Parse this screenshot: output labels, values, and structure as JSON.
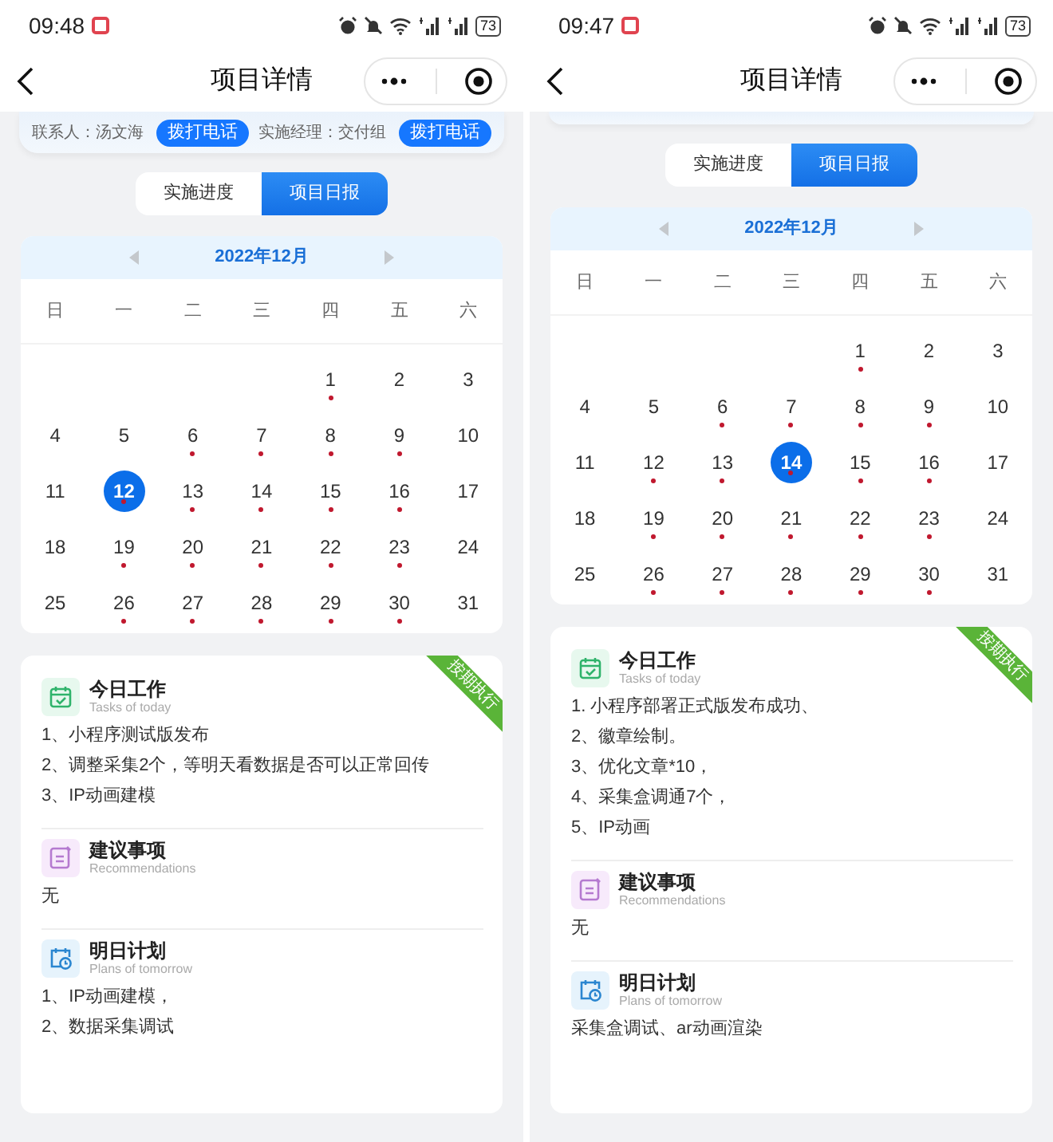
{
  "screens": [
    {
      "status_time": "09:48",
      "battery": "73",
      "title": "项目详情",
      "contacts": [
        {
          "label": "联系人：汤文海",
          "button": "拨打电话"
        },
        {
          "label": "实施经理：交付组",
          "button": "拨打电话"
        }
      ],
      "tabs": [
        {
          "label": "实施进度",
          "selected": false
        },
        {
          "label": "项目日报",
          "selected": true
        }
      ],
      "calendar": {
        "month": "2022年12月",
        "weekdays": [
          "日",
          "一",
          "二",
          "三",
          "四",
          "五",
          "六"
        ],
        "days": [
          {
            "kind": "blank"
          },
          {
            "kind": "blank"
          },
          {
            "kind": "blank"
          },
          {
            "kind": "blank"
          },
          {
            "kind": "day",
            "label": "1",
            "marked": true,
            "selected": false
          },
          {
            "kind": "day",
            "label": "2",
            "marked": false,
            "selected": false
          },
          {
            "kind": "day",
            "label": "3",
            "marked": false,
            "selected": false
          },
          {
            "kind": "day",
            "label": "4",
            "marked": false,
            "selected": false
          },
          {
            "kind": "day",
            "label": "5",
            "marked": false,
            "selected": false
          },
          {
            "kind": "day",
            "label": "6",
            "marked": true,
            "selected": false
          },
          {
            "kind": "day",
            "label": "7",
            "marked": true,
            "selected": false
          },
          {
            "kind": "day",
            "label": "8",
            "marked": true,
            "selected": false
          },
          {
            "kind": "day",
            "label": "9",
            "marked": true,
            "selected": false
          },
          {
            "kind": "day",
            "label": "10",
            "marked": false,
            "selected": false
          },
          {
            "kind": "day",
            "label": "11",
            "marked": false,
            "selected": false
          },
          {
            "kind": "day",
            "label": "12",
            "marked": true,
            "selected": true
          },
          {
            "kind": "day",
            "label": "13",
            "marked": true,
            "selected": false
          },
          {
            "kind": "day",
            "label": "14",
            "marked": true,
            "selected": false
          },
          {
            "kind": "day",
            "label": "15",
            "marked": true,
            "selected": false
          },
          {
            "kind": "day",
            "label": "16",
            "marked": true,
            "selected": false
          },
          {
            "kind": "day",
            "label": "17",
            "marked": false,
            "selected": false
          },
          {
            "kind": "day",
            "label": "18",
            "marked": false,
            "selected": false
          },
          {
            "kind": "day",
            "label": "19",
            "marked": true,
            "selected": false
          },
          {
            "kind": "day",
            "label": "20",
            "marked": true,
            "selected": false
          },
          {
            "kind": "day",
            "label": "21",
            "marked": true,
            "selected": false
          },
          {
            "kind": "day",
            "label": "22",
            "marked": true,
            "selected": false
          },
          {
            "kind": "day",
            "label": "23",
            "marked": true,
            "selected": false
          },
          {
            "kind": "day",
            "label": "24",
            "marked": false,
            "selected": false
          },
          {
            "kind": "day",
            "label": "25",
            "marked": false,
            "selected": false
          },
          {
            "kind": "day",
            "label": "26",
            "marked": true,
            "selected": false
          },
          {
            "kind": "day",
            "label": "27",
            "marked": true,
            "selected": false
          },
          {
            "kind": "day",
            "label": "28",
            "marked": true,
            "selected": false
          },
          {
            "kind": "day",
            "label": "29",
            "marked": true,
            "selected": false
          },
          {
            "kind": "day",
            "label": "30",
            "marked": true,
            "selected": false
          },
          {
            "kind": "day",
            "label": "31",
            "marked": false,
            "selected": false
          }
        ]
      },
      "ribbon": "按期执行",
      "sections": [
        {
          "kind": "tasks",
          "title": "今日工作",
          "subtitle": "Tasks of today",
          "lines": [
            "1、小程序测试版发布",
            "2、调整采集2个，等明天看数据是否可以正常回传",
            "3、IP动画建模"
          ]
        },
        {
          "kind": "recommend",
          "title": "建议事项",
          "subtitle": "Recommendations",
          "lines": [
            "无"
          ]
        },
        {
          "kind": "plan",
          "title": "明日计划",
          "subtitle": "Plans of tomorrow",
          "lines": [
            "1、IP动画建模，",
            "2、数据采集调试"
          ]
        }
      ]
    },
    {
      "status_time": "09:47",
      "battery": "73",
      "title": "项目详情",
      "tabs": [
        {
          "label": "实施进度",
          "selected": false
        },
        {
          "label": "项目日报",
          "selected": true
        }
      ],
      "calendar": {
        "month": "2022年12月",
        "weekdays": [
          "日",
          "一",
          "二",
          "三",
          "四",
          "五",
          "六"
        ],
        "days": [
          {
            "kind": "blank"
          },
          {
            "kind": "blank"
          },
          {
            "kind": "blank"
          },
          {
            "kind": "blank"
          },
          {
            "kind": "day",
            "label": "1",
            "marked": true,
            "selected": false
          },
          {
            "kind": "day",
            "label": "2",
            "marked": false,
            "selected": false
          },
          {
            "kind": "day",
            "label": "3",
            "marked": false,
            "selected": false
          },
          {
            "kind": "day",
            "label": "4",
            "marked": false,
            "selected": false
          },
          {
            "kind": "day",
            "label": "5",
            "marked": false,
            "selected": false
          },
          {
            "kind": "day",
            "label": "6",
            "marked": true,
            "selected": false
          },
          {
            "kind": "day",
            "label": "7",
            "marked": true,
            "selected": false
          },
          {
            "kind": "day",
            "label": "8",
            "marked": true,
            "selected": false
          },
          {
            "kind": "day",
            "label": "9",
            "marked": true,
            "selected": false
          },
          {
            "kind": "day",
            "label": "10",
            "marked": false,
            "selected": false
          },
          {
            "kind": "day",
            "label": "11",
            "marked": false,
            "selected": false
          },
          {
            "kind": "day",
            "label": "12",
            "marked": true,
            "selected": false
          },
          {
            "kind": "day",
            "label": "13",
            "marked": true,
            "selected": false
          },
          {
            "kind": "day",
            "label": "14",
            "marked": true,
            "selected": true
          },
          {
            "kind": "day",
            "label": "15",
            "marked": true,
            "selected": false
          },
          {
            "kind": "day",
            "label": "16",
            "marked": true,
            "selected": false
          },
          {
            "kind": "day",
            "label": "17",
            "marked": false,
            "selected": false
          },
          {
            "kind": "day",
            "label": "18",
            "marked": false,
            "selected": false
          },
          {
            "kind": "day",
            "label": "19",
            "marked": true,
            "selected": false
          },
          {
            "kind": "day",
            "label": "20",
            "marked": true,
            "selected": false
          },
          {
            "kind": "day",
            "label": "21",
            "marked": true,
            "selected": false
          },
          {
            "kind": "day",
            "label": "22",
            "marked": true,
            "selected": false
          },
          {
            "kind": "day",
            "label": "23",
            "marked": true,
            "selected": false
          },
          {
            "kind": "day",
            "label": "24",
            "marked": false,
            "selected": false
          },
          {
            "kind": "day",
            "label": "25",
            "marked": false,
            "selected": false
          },
          {
            "kind": "day",
            "label": "26",
            "marked": true,
            "selected": false
          },
          {
            "kind": "day",
            "label": "27",
            "marked": true,
            "selected": false
          },
          {
            "kind": "day",
            "label": "28",
            "marked": true,
            "selected": false
          },
          {
            "kind": "day",
            "label": "29",
            "marked": true,
            "selected": false
          },
          {
            "kind": "day",
            "label": "30",
            "marked": true,
            "selected": false
          },
          {
            "kind": "day",
            "label": "31",
            "marked": false,
            "selected": false
          }
        ]
      },
      "ribbon": "按期执行",
      "sections": [
        {
          "kind": "tasks",
          "title": "今日工作",
          "subtitle": "Tasks of today",
          "lines": [
            "1. 小程序部署正式版发布成功、",
            "2、徽章绘制。",
            "3、优化文章*10，",
            "4、采集盒调通7个，",
            "5、IP动画"
          ]
        },
        {
          "kind": "recommend",
          "title": "建议事项",
          "subtitle": "Recommendations",
          "lines": [
            "无"
          ]
        },
        {
          "kind": "plan",
          "title": "明日计划",
          "subtitle": "Plans of tomorrow",
          "lines": [
            "采集盒调试、ar动画渲染"
          ]
        }
      ]
    }
  ]
}
